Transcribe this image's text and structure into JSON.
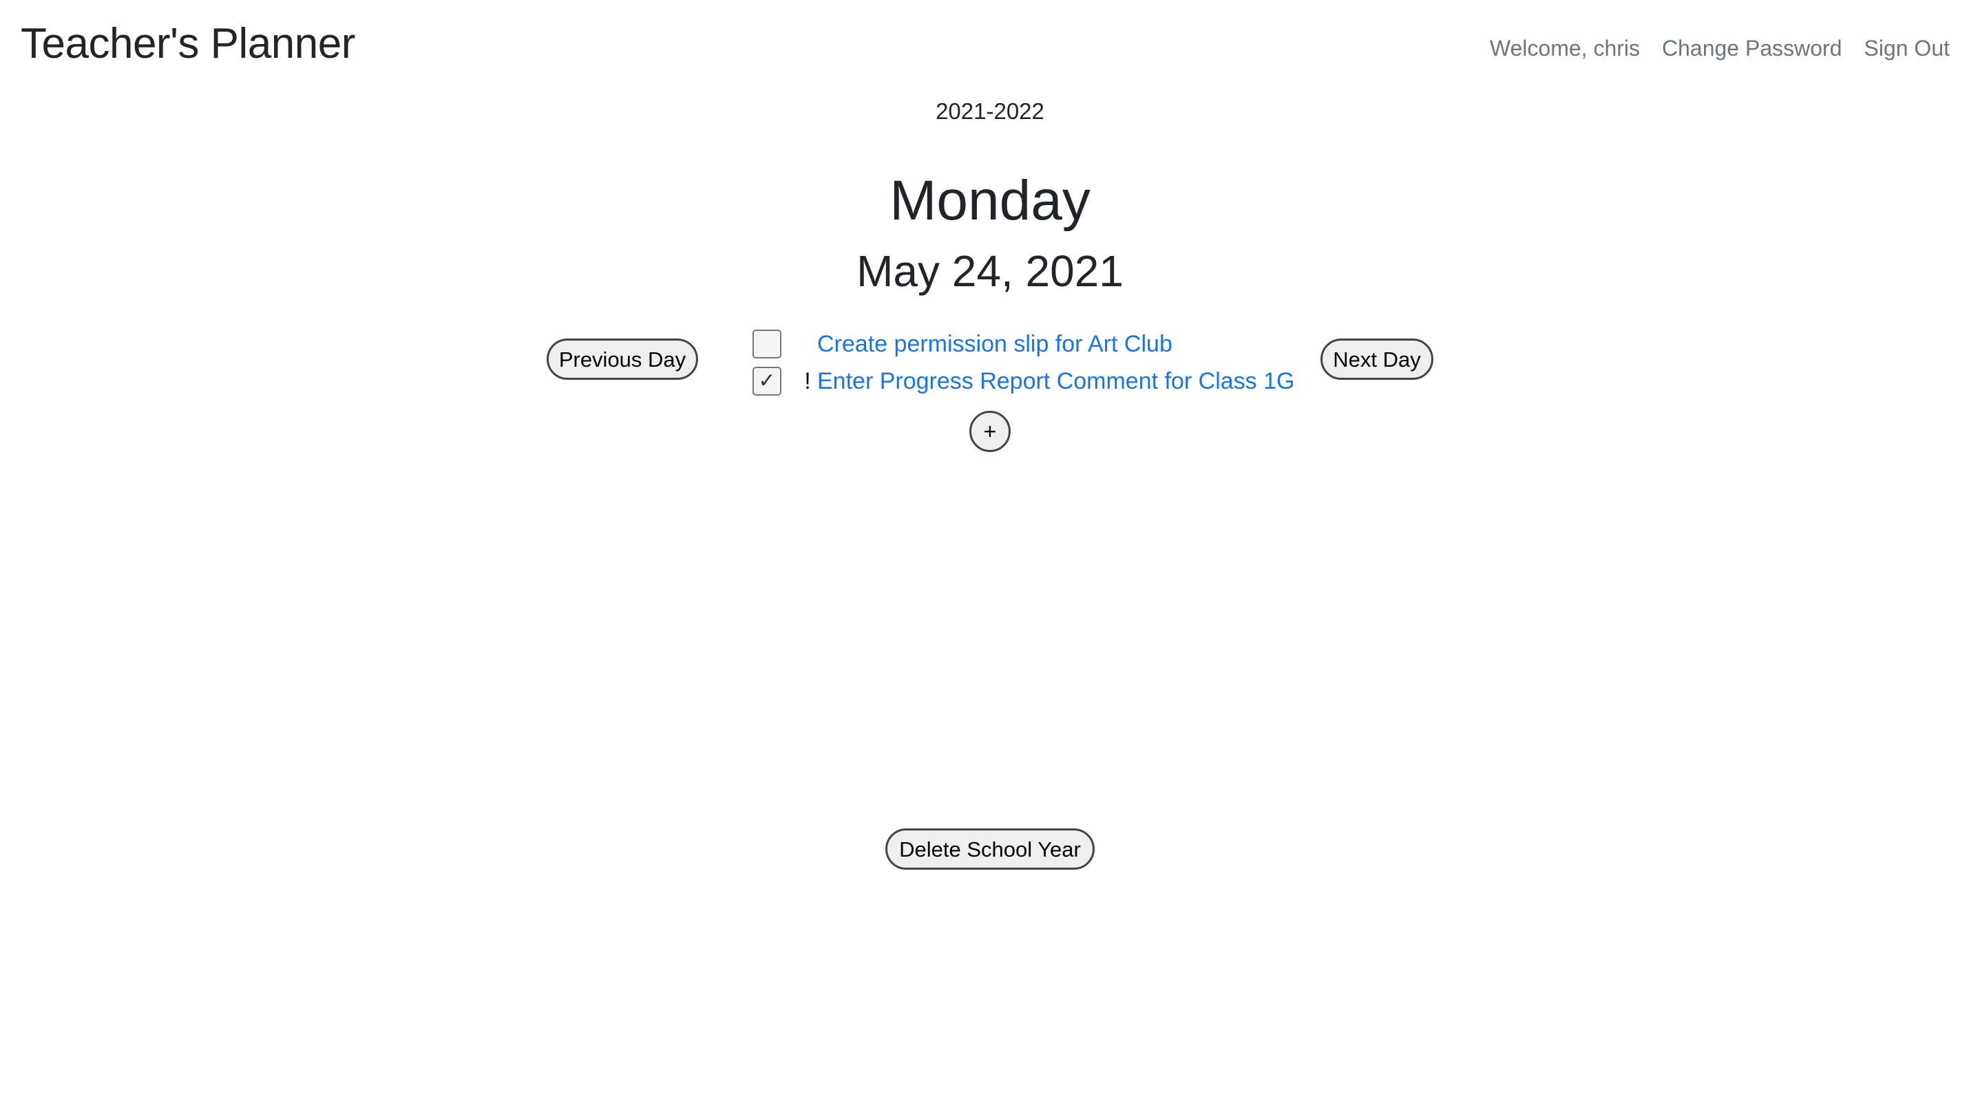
{
  "header": {
    "brand": "Teacher's Planner",
    "nav": {
      "welcome": "Welcome, chris",
      "change_password": "Change Password",
      "sign_out": "Sign Out"
    }
  },
  "school_year": "2021-2022",
  "day": {
    "weekday": "Monday",
    "date": "May 24, 2021"
  },
  "navigation": {
    "previous_label": "Previous Day",
    "next_label": "Next Day"
  },
  "tasks": [
    {
      "checked": false,
      "checkbox_mark": "",
      "priority": "",
      "title": "Create permission slip for Art Club"
    },
    {
      "checked": true,
      "checkbox_mark": "✓",
      "priority": "!",
      "title": "Enter Progress Report Comment for Class 1G"
    }
  ],
  "add_task_label": "+",
  "delete_year_label": "Delete School Year",
  "colors": {
    "link": "#1a73e8",
    "nav_text": "#6c757d",
    "heading": "#212529"
  }
}
